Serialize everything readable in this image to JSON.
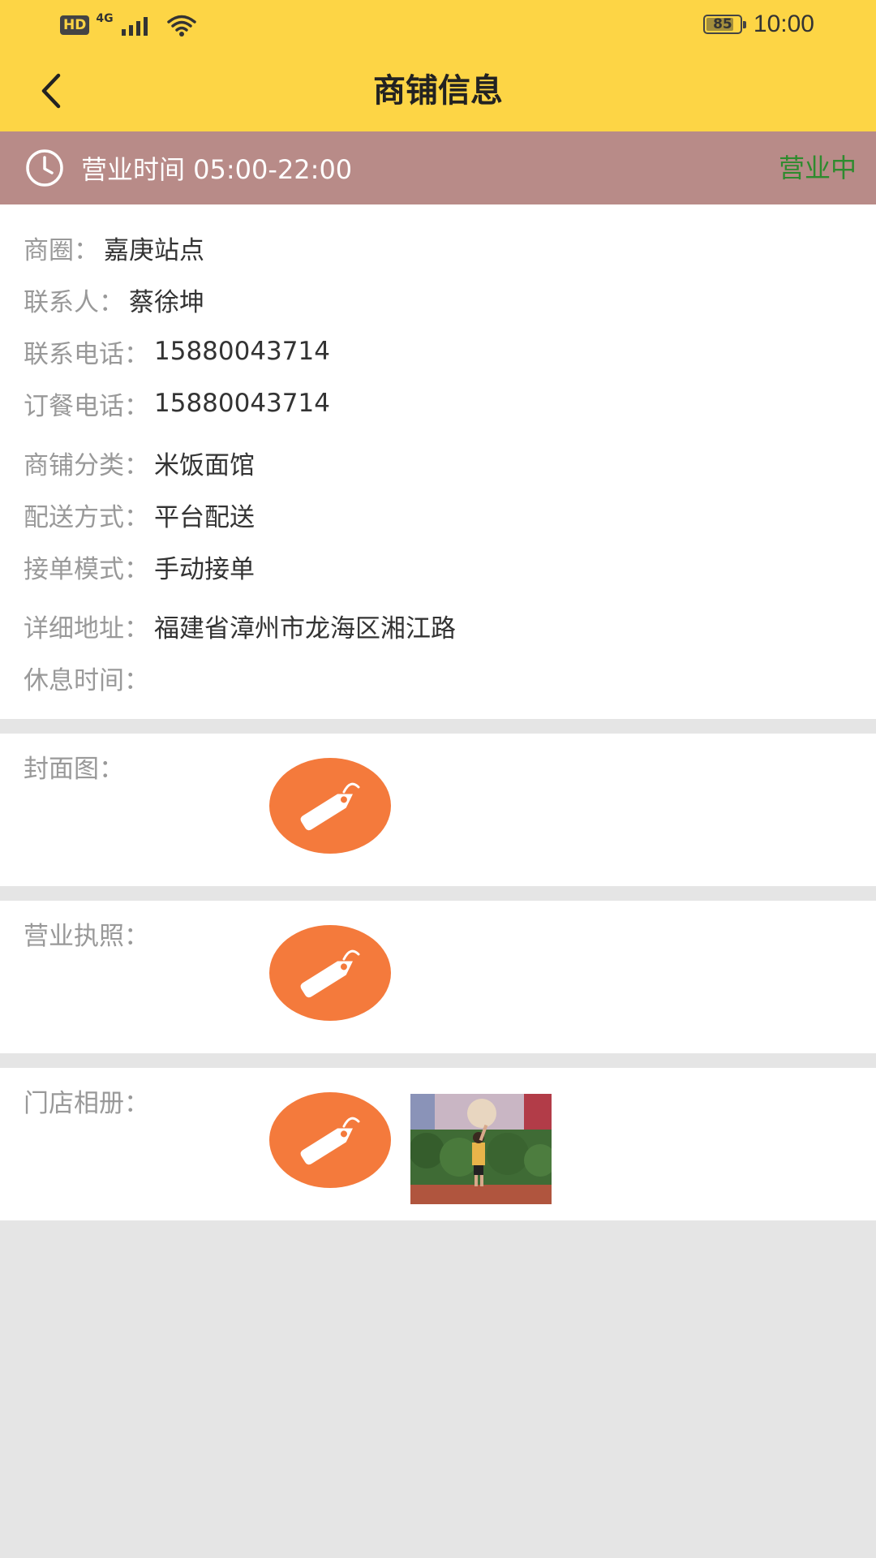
{
  "status_bar": {
    "hd": "HD",
    "network": "4G",
    "battery": "85",
    "battery_level": 0.85,
    "time": "10:00",
    "icons": [
      "hd-icon",
      "signal-icon",
      "wifi-icon",
      "battery-icon"
    ]
  },
  "nav": {
    "title": "商铺信息",
    "back_icon": "chevron-left-icon"
  },
  "hours_bar": {
    "icon": "clock-icon",
    "text": "营业时间 05:00-22:00",
    "status": "营业中",
    "status_color": "#2e8b2e",
    "background": "#b88b88"
  },
  "shop_info": {
    "rows": [
      {
        "label": "商圈：",
        "value": "嘉庚站点"
      },
      {
        "label": "联系人：",
        "value": "蔡徐坤"
      },
      {
        "label": "联系电话：",
        "value": "15880043714"
      },
      {
        "label": "订餐电话：",
        "value": "15880043714"
      },
      {
        "label": "商铺分类：",
        "value": "米饭面馆"
      },
      {
        "label": "配送方式：",
        "value": "平台配送"
      },
      {
        "label": "接单模式：",
        "value": "手动接单"
      },
      {
        "label": "详细地址：",
        "value": "福建省漳州市龙海区湘江路"
      },
      {
        "label": "休息时间：",
        "value": ""
      }
    ]
  },
  "images": {
    "cover": {
      "label": "封面图：",
      "icon": "tag-icon"
    },
    "license": {
      "label": "营业执照：",
      "icon": "tag-icon"
    },
    "album": {
      "label": "门店相册：",
      "icon": "tag-icon",
      "photo": "store-photo"
    }
  },
  "colors": {
    "header": "#fdd545",
    "tag_orange": "#f47a3c",
    "page_bg": "#e5e5e5"
  }
}
